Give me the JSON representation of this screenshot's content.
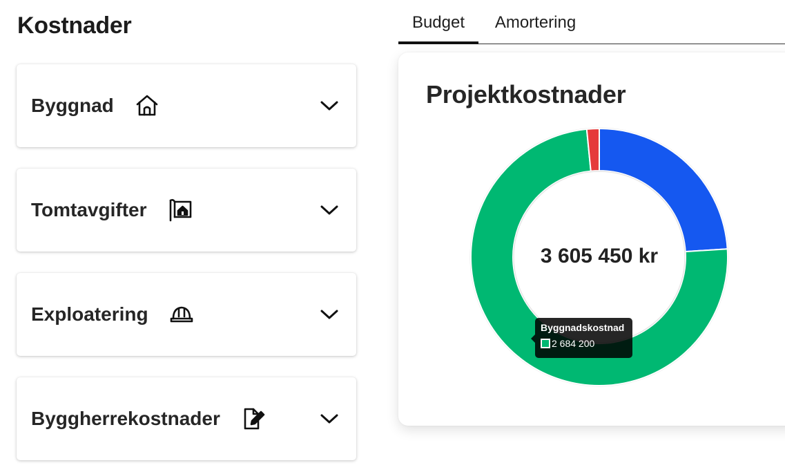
{
  "page": {
    "title": "Kostnader"
  },
  "categories": [
    {
      "label": "Byggnad",
      "icon": "house-icon"
    },
    {
      "label": "Tomtavgifter",
      "icon": "plot-sign-icon"
    },
    {
      "label": "Exploatering",
      "icon": "hard-hat-icon"
    },
    {
      "label": "Byggherrekostnader",
      "icon": "document-edit-icon"
    }
  ],
  "tabs": [
    {
      "label": "Budget",
      "active": true
    },
    {
      "label": "Amortering",
      "active": false
    }
  ],
  "panel": {
    "title": "Projektkostnader",
    "total": "3 605 450 kr"
  },
  "tooltip": {
    "title": "Byggnadskostnad",
    "value": "2 684 200"
  },
  "chart_data": {
    "type": "pie",
    "variant": "doughnut",
    "total_label": "3 605 450 kr",
    "slices": [
      {
        "value": 865000,
        "color": "#1558f0"
      },
      {
        "value": 2684200,
        "name": "Byggnadskostnad",
        "color": "#00b872"
      },
      {
        "value": 56250,
        "color": "#e53a3a"
      }
    ]
  },
  "colors": {
    "accent": "#111111",
    "blue": "#1558f0",
    "green": "#00b872",
    "red": "#e53a3a"
  }
}
